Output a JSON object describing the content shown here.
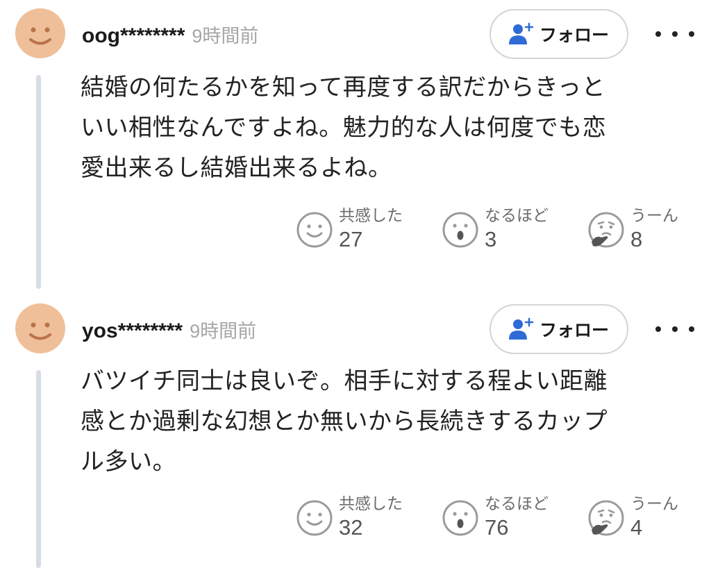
{
  "comments": [
    {
      "username": "oog********",
      "time": "9時間前",
      "follow_label": "フォロー",
      "body_lines": [
        "結婚の何たるかを知って再度する訳だからきっと",
        "いい相性なんですよね。魅力的な人は何度でも恋",
        "愛出来るし結婚出来るよね。"
      ],
      "reactions": {
        "agree": {
          "label": "共感した",
          "count": "27",
          "icon": "smile-icon"
        },
        "insight": {
          "label": "なるほど",
          "count": "3",
          "icon": "surprised-icon"
        },
        "hmm": {
          "label": "うーん",
          "count": "8",
          "icon": "thinking-icon"
        }
      }
    },
    {
      "username": "yos********",
      "time": "9時間前",
      "follow_label": "フォロー",
      "body_lines": [
        "バツイチ同士は良いぞ。相手に対する程よい距離",
        "感とか過剰な幻想とか無いから長続きするカップ",
        "ル多い。"
      ],
      "reactions": {
        "agree": {
          "label": "共感した",
          "count": "32",
          "icon": "smile-icon"
        },
        "insight": {
          "label": "なるほど",
          "count": "76",
          "icon": "surprised-icon"
        },
        "hmm": {
          "label": "うーん",
          "count": "4",
          "icon": "thinking-icon"
        }
      }
    }
  ],
  "colors": {
    "avatar": "#efbf99",
    "avatar_face": "#b9734a",
    "follow_icon": "#2f6bd6",
    "thread_line": "#d8dce4",
    "reaction_icon": "#9a9a9a"
  }
}
